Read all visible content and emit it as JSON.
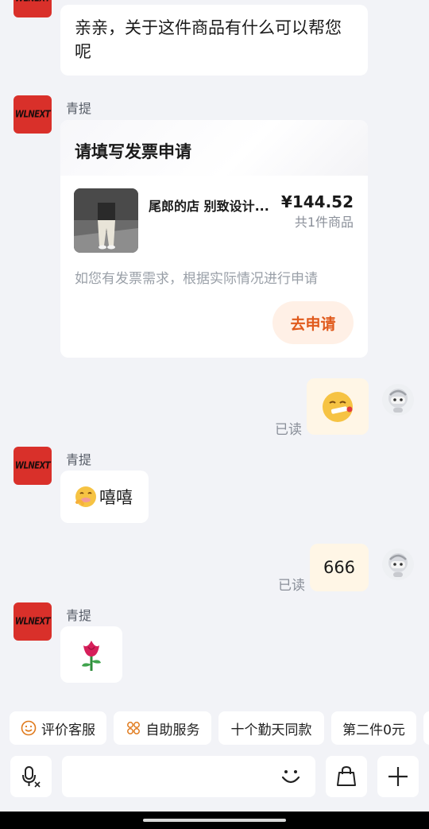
{
  "messages": {
    "m1": {
      "text": "亲亲，关于这件商品有什么可以帮您呢"
    },
    "m2": {
      "sender": "青提",
      "card_title": "请填写发票申请",
      "product_name": "尾郎的店 别致设计...",
      "price": "¥144.52",
      "count": "共1件商品",
      "desc": "如您有发票需求，根据实际情况进行申请",
      "action": "去申请"
    },
    "m3": {
      "read": "已读"
    },
    "m4": {
      "sender": "青提",
      "text": "嘻嘻"
    },
    "m5": {
      "text": "666",
      "read": "已读"
    },
    "m6": {
      "sender": "青提"
    }
  },
  "shop_logo": "WLNEXT",
  "quick_actions": [
    {
      "label": "评价客服",
      "icon": "smile-icon"
    },
    {
      "label": "自助服务",
      "icon": "grid-icon"
    },
    {
      "label": "十个勤天同款"
    },
    {
      "label": "第二件0元"
    }
  ],
  "input": {
    "placeholder": ""
  },
  "colors": {
    "shop_avatar": "#d9302a",
    "action_text": "#e05a1c",
    "action_bg": "#fff0e6",
    "my_bubble": "#fff6e6",
    "background": "#f2f3f7"
  }
}
